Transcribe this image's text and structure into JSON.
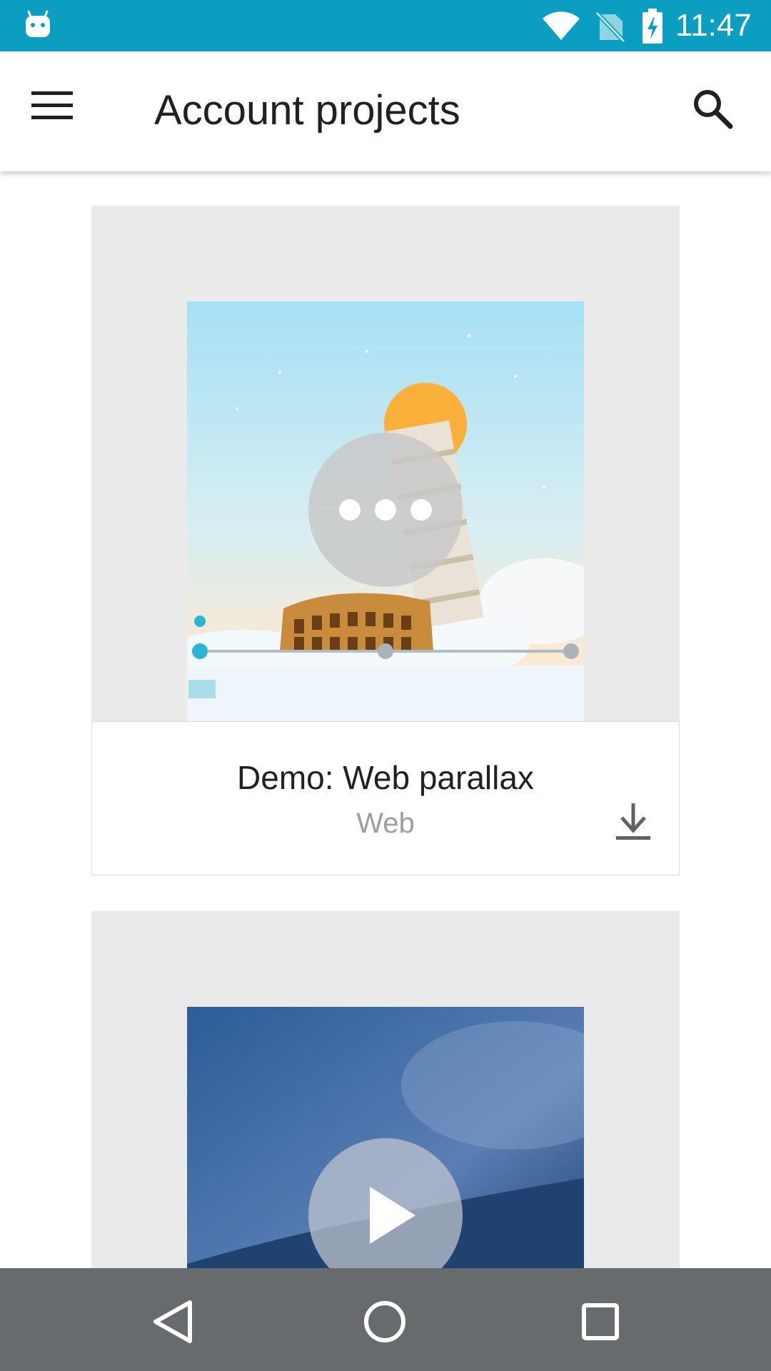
{
  "status_bar": {
    "time": "11:47",
    "icons": [
      "android-icon",
      "wifi-icon",
      "no-sim-icon",
      "battery-charging-icon"
    ],
    "color": "#0a9fc1"
  },
  "app_bar": {
    "title": "Account projects",
    "menu_icon": "hamburger-menu-icon",
    "search_icon": "search-icon"
  },
  "projects": [
    {
      "title": "Demo: Web parallax",
      "platform": "Web",
      "action_icon": "download-icon",
      "overlay_icon": "more-horizontal-icon"
    },
    {
      "overlay_icon": "play-icon"
    }
  ],
  "nav_bar": {
    "back_icon": "back-icon",
    "home_icon": "home-icon",
    "recents_icon": "recents-icon",
    "color": "#676b6e"
  }
}
